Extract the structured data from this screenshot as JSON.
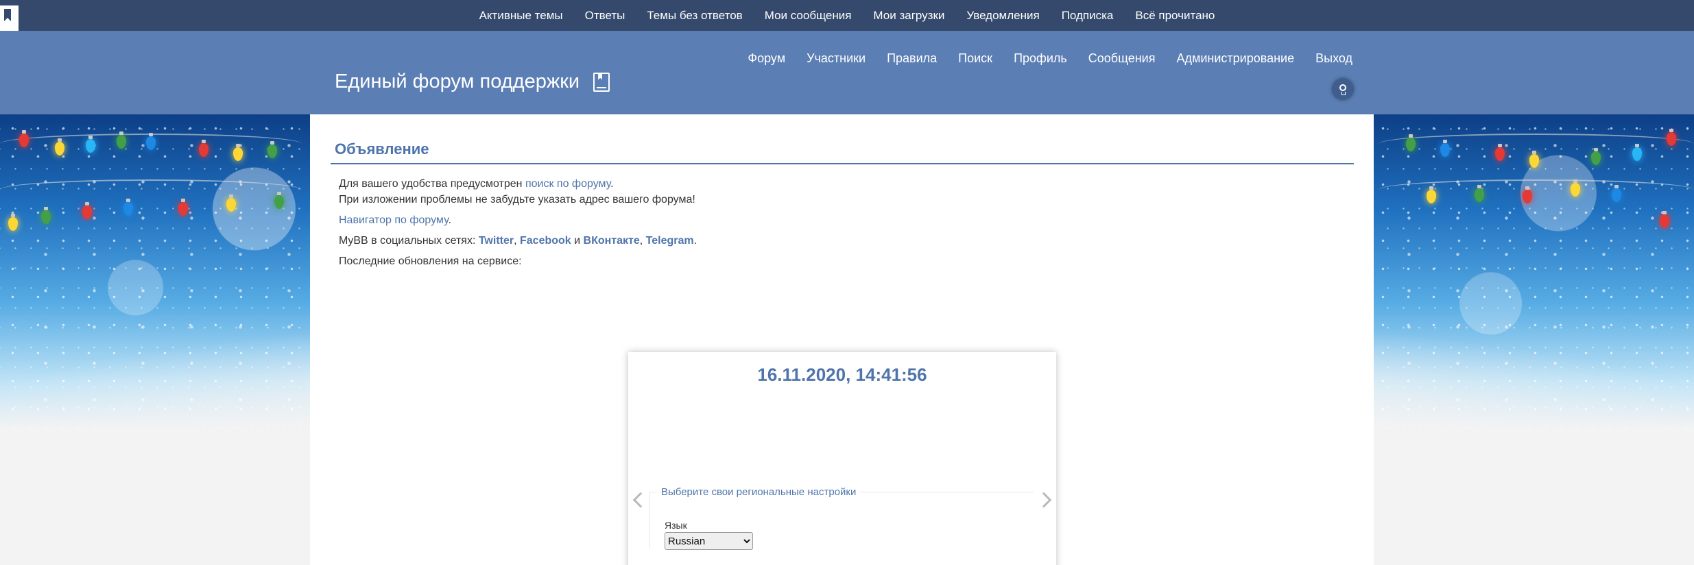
{
  "topbar": {
    "links": [
      "Активные темы",
      "Ответы",
      "Темы без ответов",
      "Мои сообщения",
      "Мои загрузки",
      "Уведомления",
      "Подписка",
      "Всё прочитано"
    ]
  },
  "header": {
    "title": "Единый форум поддержки",
    "nav": [
      "Форум",
      "Участники",
      "Правила",
      "Поиск",
      "Профиль",
      "Сообщения",
      "Администрирование",
      "Выход"
    ]
  },
  "announcement": {
    "title": "Объявление",
    "line1_prefix": "Для вашего удобства предусмотрен ",
    "line1_link": "поиск по форуму",
    "line1_suffix": ".",
    "line2": "При изложении проблемы не забудьте указать адрес вашего форума!",
    "navigator_link": "Навигатор по форуму",
    "navigator_suffix": ".",
    "social_prefix": "MyBB в социальных сетях: ",
    "social_links": [
      "Twitter",
      "Facebook",
      "ВКонтакте",
      "Telegram"
    ],
    "social_sep1": ", ",
    "social_sep2": " и ",
    "social_sep3": ", ",
    "social_end": ".",
    "updates": "Последние обновления на сервисе:"
  },
  "card": {
    "datetime": "16.11.2020, 14:41:56",
    "legend": "Выберите свои региональные настройки",
    "language_label": "Язык",
    "language_selected": "Russian"
  },
  "colors": {
    "topbar": "#34496b",
    "header": "#5b7eb4",
    "accent": "#4e75ab"
  }
}
